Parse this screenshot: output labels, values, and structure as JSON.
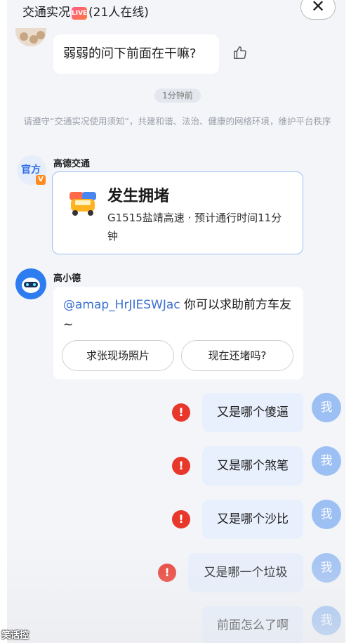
{
  "header": {
    "title_prefix": "交通实况",
    "live_badge": "LIVE",
    "online_count": "(21人在线)",
    "close_symbol": "✕"
  },
  "messages": {
    "question": "弱弱的问下前面在干嘛?",
    "time_divider": "1分钟前",
    "notice": "请遵守“交通实况使用须知”，共建和谐、法治、健康的网络环境，维护平台秩序"
  },
  "official": {
    "sender": "高德交通",
    "avatar_text": "官方",
    "verified_mark": "V",
    "card_title": "发生拥堵",
    "card_desc": "G1515盐靖高速 · 预计通行时间11分钟"
  },
  "assistant": {
    "sender": "高小德",
    "mention": "@amap_HrJIESWJac",
    "text": " 你可以求助前方车友~",
    "btn_photo": "求张现场照片",
    "btn_still_jam": "现在还堵吗?"
  },
  "my_messages": [
    {
      "text": "又是哪个傻逼",
      "failed": true
    },
    {
      "text": "又是哪个煞笔",
      "failed": true
    },
    {
      "text": "又是哪个沙比",
      "failed": true
    },
    {
      "text": "又是哪一个垃圾",
      "failed": true
    },
    {
      "text": "前面怎么了啊",
      "failed": false
    }
  ],
  "my_avatar_label": "我",
  "error_mark": "!",
  "watermark": "笑话控",
  "colors": {
    "accent_blue": "#2d7cf0",
    "error_red": "#e8382b",
    "my_bubble": "#e8f0fd"
  }
}
